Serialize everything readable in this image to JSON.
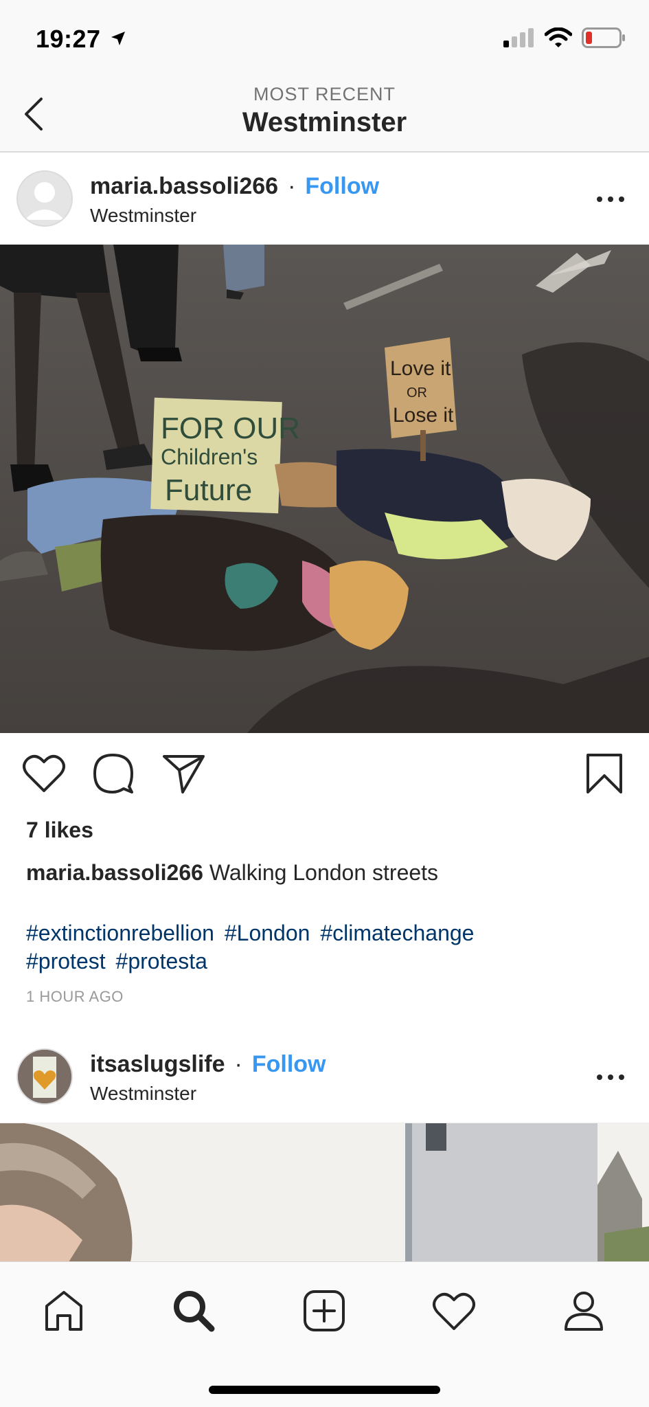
{
  "status_bar": {
    "time": "19:27"
  },
  "nav": {
    "subtitle": "MOST RECENT",
    "title": "Westminster"
  },
  "post1": {
    "username": "maria.bassoli266",
    "separator": "·",
    "follow_label": "Follow",
    "location": "Westminster",
    "photo": {
      "sign1_lines": [
        "FOR OUR",
        "Children's",
        "Future"
      ],
      "sign2_lines": [
        "Love it",
        "OR",
        "Lose it"
      ]
    },
    "likes": "7 likes",
    "caption_user": "maria.bassoli266",
    "caption_text": "Walking London streets",
    "hashtags": [
      "#extinctionrebellion",
      "#London",
      "#climatechange",
      "#protest",
      "#protesta"
    ],
    "timestamp": "1 HOUR AGO"
  },
  "post2": {
    "username": "itsaslugslife",
    "separator": "·",
    "follow_label": "Follow",
    "location": "Westminster"
  },
  "colors": {
    "follow": "#3897f0",
    "hashtag": "#003569",
    "text": "#262626"
  },
  "tab_bar": {
    "tabs": [
      "home-icon",
      "search-icon",
      "new-post-icon",
      "activity-icon",
      "profile-icon"
    ]
  }
}
